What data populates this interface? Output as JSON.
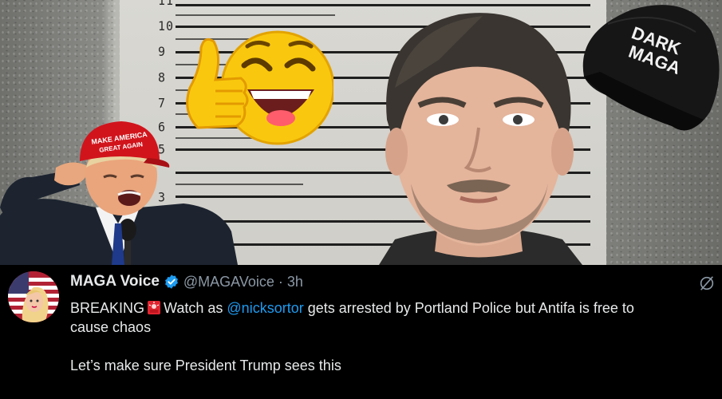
{
  "meme": {
    "height_chart_numbers": [
      "11",
      "10",
      "9",
      "8",
      "7",
      "6",
      "5",
      "3"
    ],
    "cap_text_line1": "MAKE AMERICA",
    "cap_text_line2": "GREAT AGAIN",
    "dark_maga_line1": "DARK",
    "dark_maga_line2": "MAGA",
    "colors": {
      "maga_red": "#d1141c",
      "emoji_yellow": "#f9c80e",
      "wall": "#c9c8c2"
    }
  },
  "tweet": {
    "display_name": "MAGA Voice",
    "handle": "@MAGAVoice",
    "separator": "·",
    "time": "3h",
    "text_breaking": "BREAKING",
    "text_watch": "Watch as",
    "mention": "@nicksortor",
    "text_rest": "gets arrested by Portland Police but Antifa is free to",
    "text_line2": "cause chaos",
    "text_para2": "Let’s make sure President Trump sees this",
    "icons": {
      "verified": "verified-badge-icon",
      "siren": "siren-emoji-icon",
      "grok": "grok-icon"
    },
    "colors": {
      "verified": "#1d9bf0",
      "mention": "#1d9bf0",
      "text": "#e7e9ea",
      "muted": "#8b98a5"
    }
  }
}
